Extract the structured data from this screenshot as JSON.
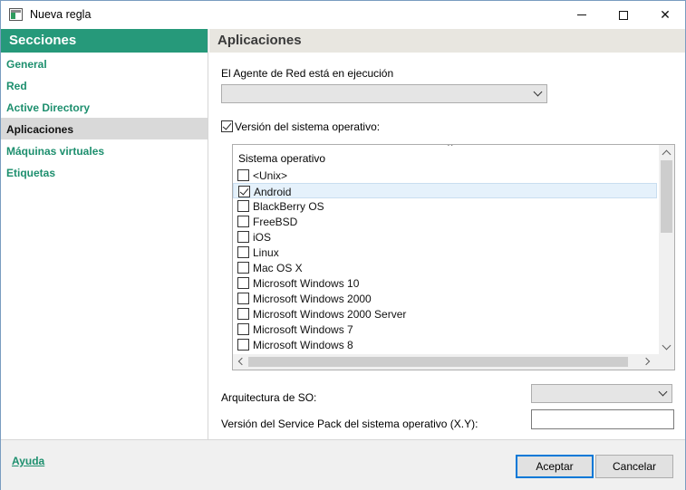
{
  "window": {
    "title": "Nueva regla"
  },
  "sidebar": {
    "header": "Secciones",
    "items": [
      {
        "label": "General",
        "active": false
      },
      {
        "label": "Red",
        "active": false
      },
      {
        "label": "Active Directory",
        "active": false
      },
      {
        "label": "Aplicaciones",
        "active": true
      },
      {
        "label": "Máquinas virtuales",
        "active": false
      },
      {
        "label": "Etiquetas",
        "active": false
      }
    ]
  },
  "main": {
    "header": "Aplicaciones",
    "agent_label": "El Agente de Red está en ejecución",
    "agent_value": "",
    "os_version_label": "Versión del sistema operativo:",
    "os_version_checked": true,
    "os_list": {
      "column_header": "Sistema operativo",
      "items": [
        {
          "name": "<Unix>",
          "checked": false,
          "selected": false
        },
        {
          "name": "Android",
          "checked": true,
          "selected": true
        },
        {
          "name": "BlackBerry OS",
          "checked": false,
          "selected": false
        },
        {
          "name": "FreeBSD",
          "checked": false,
          "selected": false
        },
        {
          "name": "iOS",
          "checked": false,
          "selected": false
        },
        {
          "name": "Linux",
          "checked": false,
          "selected": false
        },
        {
          "name": "Mac OS X",
          "checked": false,
          "selected": false
        },
        {
          "name": "Microsoft Windows 10",
          "checked": false,
          "selected": false
        },
        {
          "name": "Microsoft Windows 2000",
          "checked": false,
          "selected": false
        },
        {
          "name": "Microsoft Windows 2000 Server",
          "checked": false,
          "selected": false
        },
        {
          "name": "Microsoft Windows 7",
          "checked": false,
          "selected": false
        },
        {
          "name": "Microsoft Windows 8",
          "checked": false,
          "selected": false
        }
      ]
    },
    "arch_label": "Arquitectura de SO:",
    "arch_value": "",
    "sp_label": "Versión del Service Pack del sistema operativo (X.Y):",
    "sp_value": ""
  },
  "footer": {
    "help": "Ayuda",
    "accept": "Aceptar",
    "cancel": "Cancelar"
  },
  "colors": {
    "accent": "#26997a",
    "link": "#1d8f6e",
    "header_bg": "#e8e6e0",
    "selection": "#e5f1fb"
  },
  "icons": {
    "app": "rule-window-icon",
    "minimize": "minimize-icon",
    "maximize": "maximize-icon",
    "close": "close-icon"
  }
}
